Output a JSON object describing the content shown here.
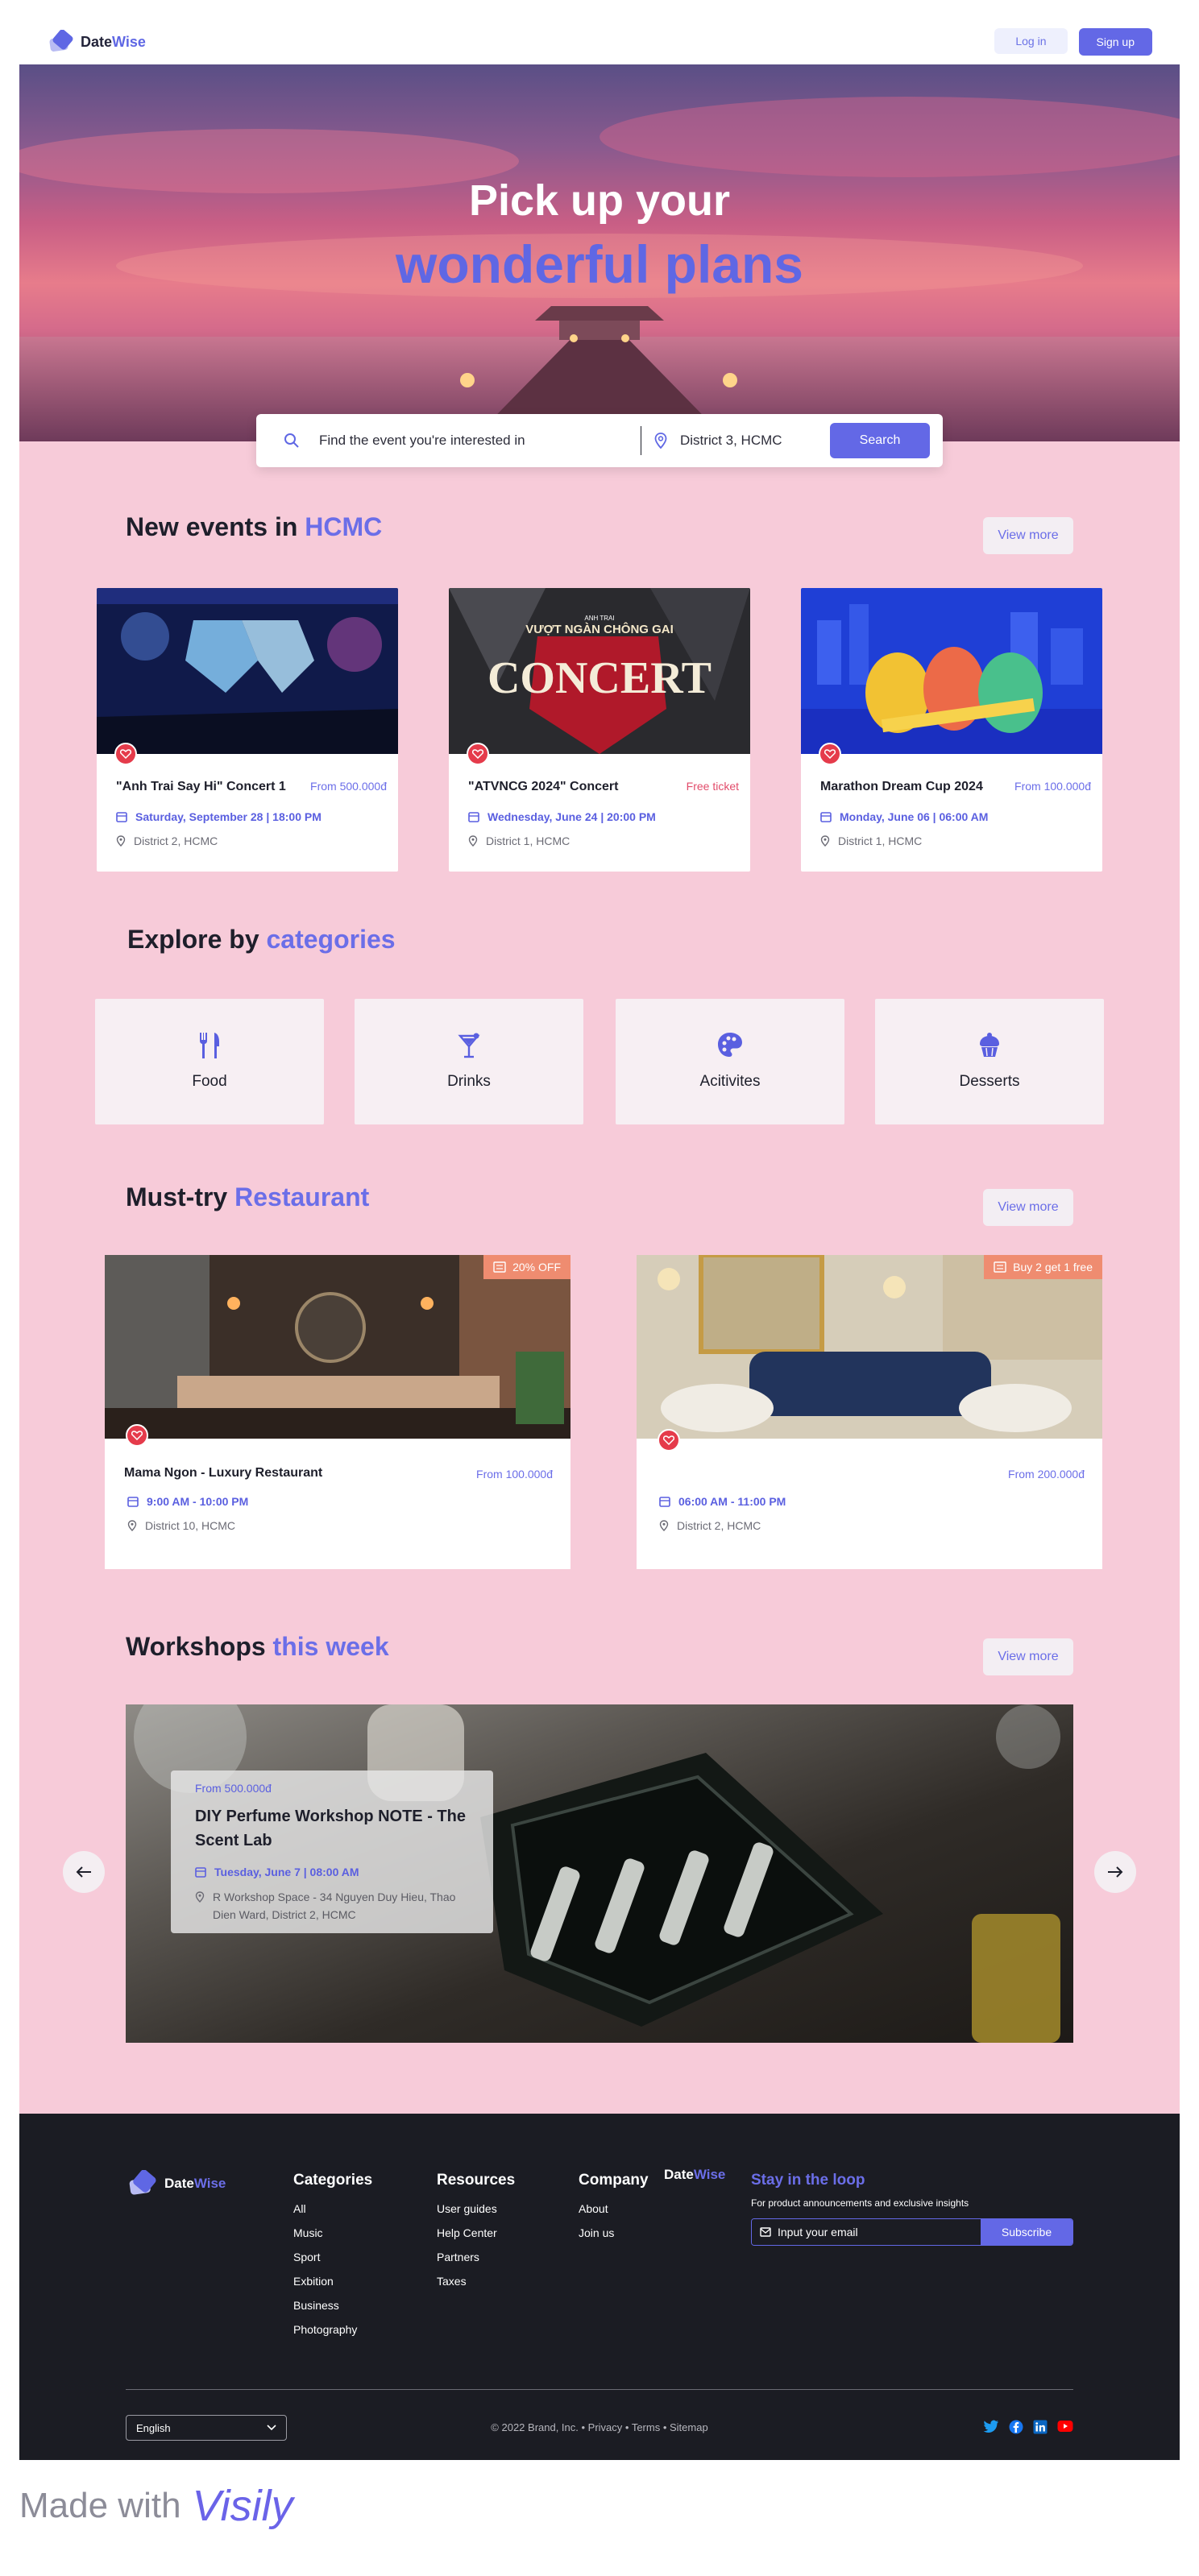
{
  "header": {
    "brand_a": "Date",
    "brand_b": "Wise",
    "login": "Log in",
    "signup": "Sign up"
  },
  "hero": {
    "title1": "Pick up your",
    "title2": "wonderful plans",
    "search_placeholder": "Find the event you're interested in",
    "location": "District 3, HCMC",
    "search_btn": "Search"
  },
  "events": {
    "title": "New events in",
    "title_hl": "HCMC",
    "view_more": "View more",
    "items": [
      {
        "name": "\"Anh Trai Say Hi\" Concert 1",
        "price": "From 500.000đ",
        "date": "Saturday, September 28 | 18:00 PM",
        "location": "District 2, HCMC"
      },
      {
        "name": "\"ATVNCG 2024\" Concert",
        "price": "Free ticket",
        "date": "Wednesday, June 24 | 20:00 PM",
        "location": "District 1, HCMC",
        "img_text_a": "ANH TRAI",
        "img_text_b": "VƯỢT NGÀN CHÔNG GAI",
        "img_text_c": "CONCERT"
      },
      {
        "name": "Marathon Dream Cup 2024",
        "price": "From 100.000đ",
        "date": "Monday, June 06 | 06:00 AM",
        "location": "District 1, HCMC"
      }
    ]
  },
  "categories": {
    "title": "Explore by",
    "title_hl": "categories",
    "items": [
      {
        "label": "Food",
        "icon": "utensils-icon"
      },
      {
        "label": "Drinks",
        "icon": "cocktail-icon"
      },
      {
        "label": "Acitivites",
        "icon": "palette-icon"
      },
      {
        "label": "Desserts",
        "icon": "cupcake-icon"
      }
    ]
  },
  "restaurants": {
    "title": "Must-try",
    "title_hl": "Restaurant",
    "view_more": "View more",
    "items": [
      {
        "badge": "20% OFF",
        "name": "Mama Ngon - Luxury Restaurant",
        "price": "From 100.000đ",
        "time": "9:00 AM - 10:00 PM",
        "location": "District 10, HCMC"
      },
      {
        "badge": "Buy 2 get 1 free",
        "name": "",
        "price": "From 200.000đ",
        "time": "06:00 AM - 11:00 PM",
        "location": "District 2, HCMC"
      }
    ]
  },
  "workshops": {
    "title": "Workshops",
    "title_hl": "this week",
    "view_more": "View more",
    "item": {
      "price": "From  500.000đ",
      "name": "DIY Perfume Workshop NOTE - The Scent Lab",
      "date": "Tuesday, June 7 | 08:00 AM",
      "location": "R Workshop Space - 34 Nguyen Duy Hieu, Thao Dien Ward, District 2, HCMC"
    }
  },
  "footer": {
    "categories": {
      "title": "Categories",
      "items": [
        "All",
        "Music",
        "Sport",
        "Exbition",
        "Business",
        "Photography"
      ]
    },
    "resources": {
      "title": "Resources",
      "items": [
        "User guides",
        "Help Center",
        "Partners",
        "Taxes"
      ]
    },
    "company": {
      "title": "Company",
      "items": [
        "About",
        "Join us"
      ]
    },
    "brand_text": "DateWise",
    "newsletter": {
      "title": "Stay in the loop",
      "desc": "For product announcements and exclusive insights",
      "placeholder": "Input your email",
      "btn": "Subscribe"
    },
    "language": "English",
    "copyright": "© 2022 Brand, Inc. • Privacy • Terms • Sitemap"
  },
  "made_with": {
    "text": "Made with",
    "brand": "Visily"
  },
  "colors": {
    "accent": "#6368e6",
    "bg_pink": "#f7cbd9",
    "footer": "#1b1c23",
    "heart": "#e53b4b",
    "badge": "#ef8c70"
  }
}
